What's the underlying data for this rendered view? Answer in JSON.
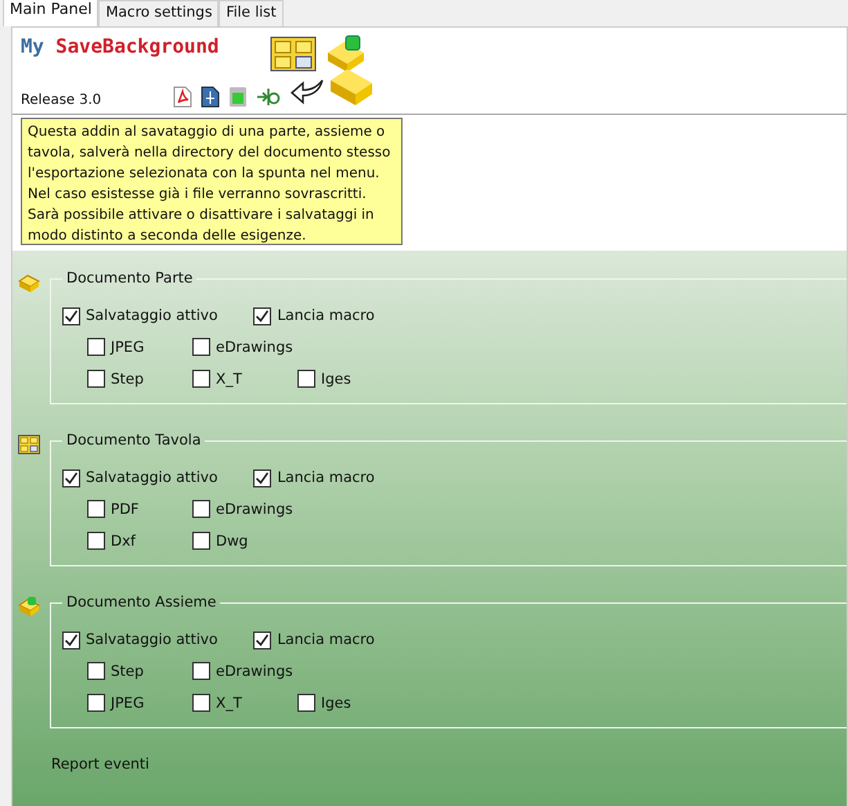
{
  "tabs": [
    {
      "label": "Main Panel",
      "selected": true
    },
    {
      "label": "Macro settings",
      "selected": false
    },
    {
      "label": "File list",
      "selected": false
    }
  ],
  "header": {
    "title_prefix": "My",
    "title_main": "SaveBackground",
    "release": "Release 3.0"
  },
  "description": "Questa addin al savataggio di una parte, assieme o tavola, salverà nella directory del documento stesso l'esportazione selezionata con la spunta nel menu. Nel caso esistesse già i file verranno sovrascritti. Sarà possibile attivare o disattivare i salvataggi in modo distinto a seconda delle esigenze.",
  "groups": [
    {
      "title": "Documento Parte",
      "kind": "part",
      "main": [
        {
          "label": "Salvataggio attivo",
          "checked": true
        },
        {
          "label": "Lancia macro",
          "checked": true
        }
      ],
      "options": [
        [
          {
            "label": "JPEG",
            "checked": false
          },
          {
            "label": "eDrawings",
            "checked": false
          }
        ],
        [
          {
            "label": "Step",
            "checked": false
          },
          {
            "label": "X_T",
            "checked": false
          },
          {
            "label": "Iges",
            "checked": false
          }
        ]
      ]
    },
    {
      "title": "Documento Tavola",
      "kind": "drawing",
      "main": [
        {
          "label": "Salvataggio attivo",
          "checked": true
        },
        {
          "label": "Lancia macro",
          "checked": true
        }
      ],
      "options": [
        [
          {
            "label": "PDF",
            "checked": false
          },
          {
            "label": "eDrawings",
            "checked": false
          }
        ],
        [
          {
            "label": "Dxf",
            "checked": false
          },
          {
            "label": "Dwg",
            "checked": false
          }
        ]
      ]
    },
    {
      "title": "Documento Assieme",
      "kind": "assembly",
      "main": [
        {
          "label": "Salvataggio attivo",
          "checked": true
        },
        {
          "label": "Lancia macro",
          "checked": true
        }
      ],
      "options": [
        [
          {
            "label": "Step",
            "checked": false
          },
          {
            "label": "eDrawings",
            "checked": false
          }
        ],
        [
          {
            "label": "JPEG",
            "checked": false
          },
          {
            "label": "X_T",
            "checked": false
          },
          {
            "label": "Iges",
            "checked": false
          }
        ]
      ]
    }
  ],
  "report_label": "Report eventi"
}
